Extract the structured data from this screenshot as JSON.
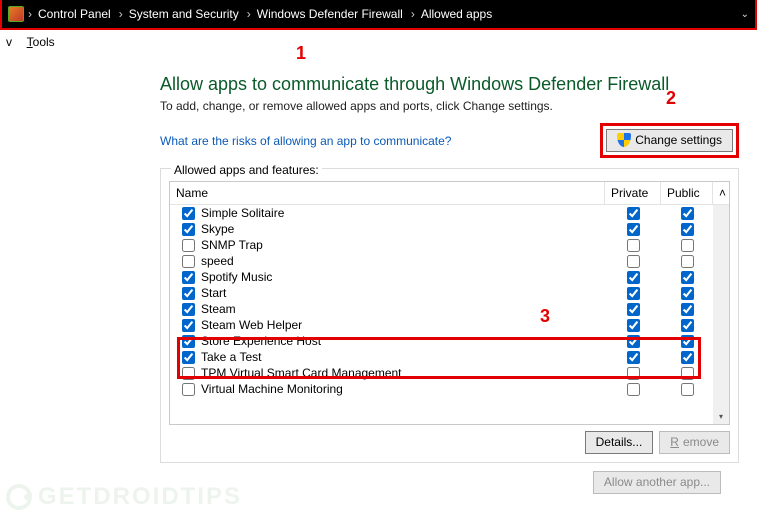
{
  "breadcrumb": {
    "items": [
      "Control Panel",
      "System and Security",
      "Windows Defender Firewall",
      "Allowed apps"
    ]
  },
  "menubar": {
    "view_suffix": "v",
    "tools": "Tools"
  },
  "annotations": {
    "n1": "1",
    "n2": "2",
    "n3": "3"
  },
  "heading": "Allow apps to communicate through Windows Defender Firewall",
  "subtext": "To add, change, or remove allowed apps and ports, click Change settings.",
  "risks_link": "What are the risks of allowing an app to communicate?",
  "change_settings_label": "Change settings",
  "group_label": "Allowed apps and features:",
  "columns": {
    "name": "Name",
    "private": "Private",
    "public": "Public"
  },
  "rows": [
    {
      "name": "Simple Solitaire",
      "enabled": true,
      "private": true,
      "public": true
    },
    {
      "name": "Skype",
      "enabled": true,
      "private": true,
      "public": true
    },
    {
      "name": "SNMP Trap",
      "enabled": false,
      "private": false,
      "public": false
    },
    {
      "name": "speed",
      "enabled": false,
      "private": false,
      "public": false
    },
    {
      "name": "Spotify Music",
      "enabled": true,
      "private": true,
      "public": true
    },
    {
      "name": "Start",
      "enabled": true,
      "private": true,
      "public": true
    },
    {
      "name": "Steam",
      "enabled": true,
      "private": true,
      "public": true
    },
    {
      "name": "Steam Web Helper",
      "enabled": true,
      "private": true,
      "public": true
    },
    {
      "name": "Store Experience Host",
      "enabled": true,
      "private": true,
      "public": true
    },
    {
      "name": "Take a Test",
      "enabled": true,
      "private": true,
      "public": true
    },
    {
      "name": "TPM Virtual Smart Card Management",
      "enabled": false,
      "private": false,
      "public": false
    },
    {
      "name": "Virtual Machine Monitoring",
      "enabled": false,
      "private": false,
      "public": false
    }
  ],
  "buttons": {
    "details": "Details...",
    "remove": "Remove",
    "allow_another": "Allow another app..."
  },
  "watermark": "GETDROIDTIPS"
}
